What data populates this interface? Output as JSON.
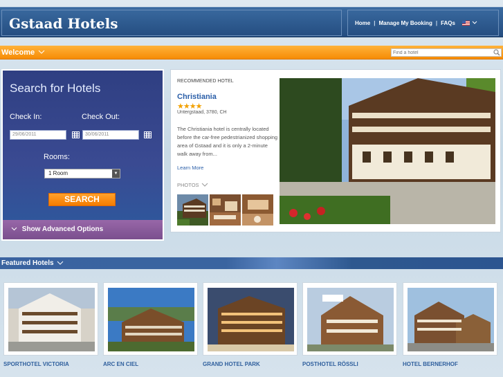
{
  "header": {
    "site_title": "Gstaad Hotels",
    "nav": [
      {
        "label": "Home"
      },
      {
        "label": "Manage My Booking"
      },
      {
        "label": "FAQs"
      }
    ],
    "separator": "|",
    "language_icon": "us-flag-icon"
  },
  "welcome_bar": {
    "label": "Welcome",
    "find_placeholder": "Find a hotel",
    "search_icon": "magnifier-icon",
    "accent": "#f68c05"
  },
  "search": {
    "title": "Search for Hotels",
    "check_in_label": "Check In:",
    "check_out_label": "Check Out:",
    "check_in_value": "29/06/2011",
    "check_out_value": "30/06/2011",
    "rooms_label": "Rooms:",
    "rooms_value": "1 Room",
    "search_button": "SEARCH",
    "advanced_options": "Show Advanced Options"
  },
  "recommended": {
    "section_label": "RECOMMENDED HOTEL",
    "name": "Christiania",
    "stars": "★★★★",
    "address": "Untergstaad, 3780, CH",
    "description": "The Christiania hotel is centrally located before the car-free pedestrianized shopping area of Gstaad and it is only a 2-minute walk away from...",
    "learn_more": "Learn More",
    "photos_label": "PHOTOS"
  },
  "featured": {
    "label": "Featured Hotels",
    "hotels": [
      {
        "name": "SPORTHOTEL VICTORIA"
      },
      {
        "name": "ARC EN CIEL"
      },
      {
        "name": "GRAND HOTEL PARK"
      },
      {
        "name": "POSTHOTEL RÖSSLI"
      },
      {
        "name": "HOTEL BERNERHOF"
      }
    ]
  },
  "colors": {
    "header_blue": "#244d80",
    "link_blue": "#2a5ea8",
    "panel_purple": "#3a4a92",
    "advanced_purple": "#7a4f8e",
    "star_gold": "#f2a100"
  }
}
